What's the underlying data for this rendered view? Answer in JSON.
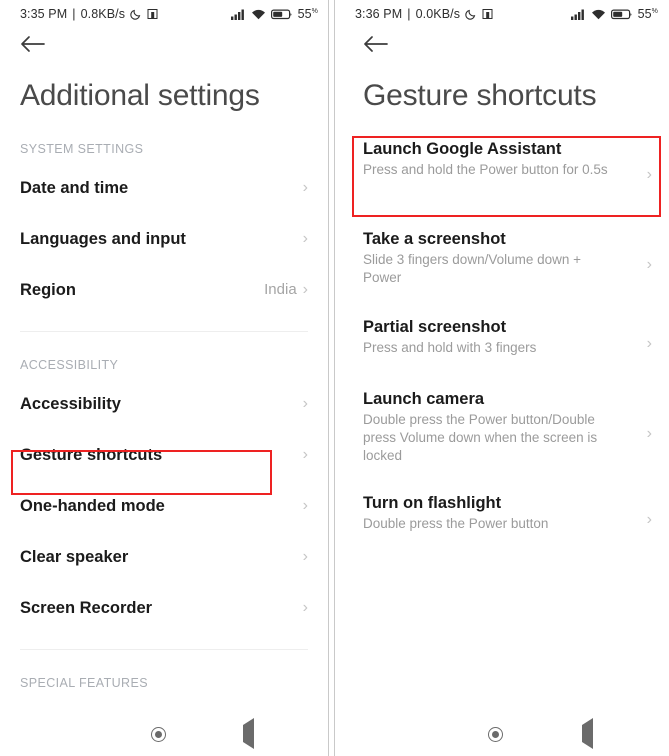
{
  "left": {
    "statusbar": {
      "time": "3:35 PM",
      "separator": "|",
      "netspeed": "0.8KB/s",
      "moon_icon": "moon-icon",
      "app_icon": "notification-icon",
      "signal_icon": "signal-icon",
      "wifi_icon": "wifi-icon",
      "battery_icon": "battery-icon",
      "battery_level": "55",
      "battery_unit": "%"
    },
    "back_icon": "back-arrow-icon",
    "title": "Additional settings",
    "sections": [
      {
        "header": "SYSTEM SETTINGS",
        "items": [
          {
            "title": "Date and time",
            "value": "",
            "chevron": "›"
          },
          {
            "title": "Languages and input",
            "value": "",
            "chevron": "›"
          },
          {
            "title": "Region",
            "value": "India",
            "chevron": "›"
          }
        ]
      },
      {
        "header": "ACCESSIBILITY",
        "items": [
          {
            "title": "Accessibility",
            "value": "",
            "chevron": "›"
          },
          {
            "title": "Gesture shortcuts",
            "value": "",
            "chevron": "›"
          },
          {
            "title": "One-handed mode",
            "value": "",
            "chevron": "›"
          },
          {
            "title": "Clear speaker",
            "value": "",
            "chevron": "›"
          },
          {
            "title": "Screen Recorder",
            "value": "",
            "chevron": "›"
          }
        ]
      },
      {
        "header": "SPECIAL FEATURES",
        "items": []
      }
    ],
    "highlight": {
      "target": "Gesture shortcuts",
      "color": "#ee2222"
    }
  },
  "right": {
    "statusbar": {
      "time": "3:36 PM",
      "separator": "|",
      "netspeed": "0.0KB/s",
      "moon_icon": "moon-icon",
      "app_icon": "notification-icon",
      "signal_icon": "signal-icon",
      "wifi_icon": "wifi-icon",
      "battery_icon": "battery-icon",
      "battery_level": "55",
      "battery_unit": "%"
    },
    "back_icon": "back-arrow-icon",
    "title": "Gesture shortcuts",
    "items": [
      {
        "title": "Launch Google Assistant",
        "subtitle": "Press and hold the Power button for 0.5s",
        "chevron": "›"
      },
      {
        "title": "Take a screenshot",
        "subtitle": "Slide 3 fingers down/Volume down + Power",
        "chevron": "›"
      },
      {
        "title": "Partial screenshot",
        "subtitle": "Press and hold with 3 fingers",
        "chevron": "›"
      },
      {
        "title": "Launch camera",
        "subtitle": "Double press the Power button/Double press Volume down when the screen is locked",
        "chevron": "›"
      },
      {
        "title": "Turn on flashlight",
        "subtitle": "Double press the Power button",
        "chevron": "›"
      }
    ],
    "highlight": {
      "target": "Launch Google Assistant",
      "color": "#ee2222"
    }
  },
  "navbar": {
    "recents_icon": "recents-square-icon",
    "home_icon": "home-circle-icon",
    "back_icon": "back-triangle-icon"
  }
}
